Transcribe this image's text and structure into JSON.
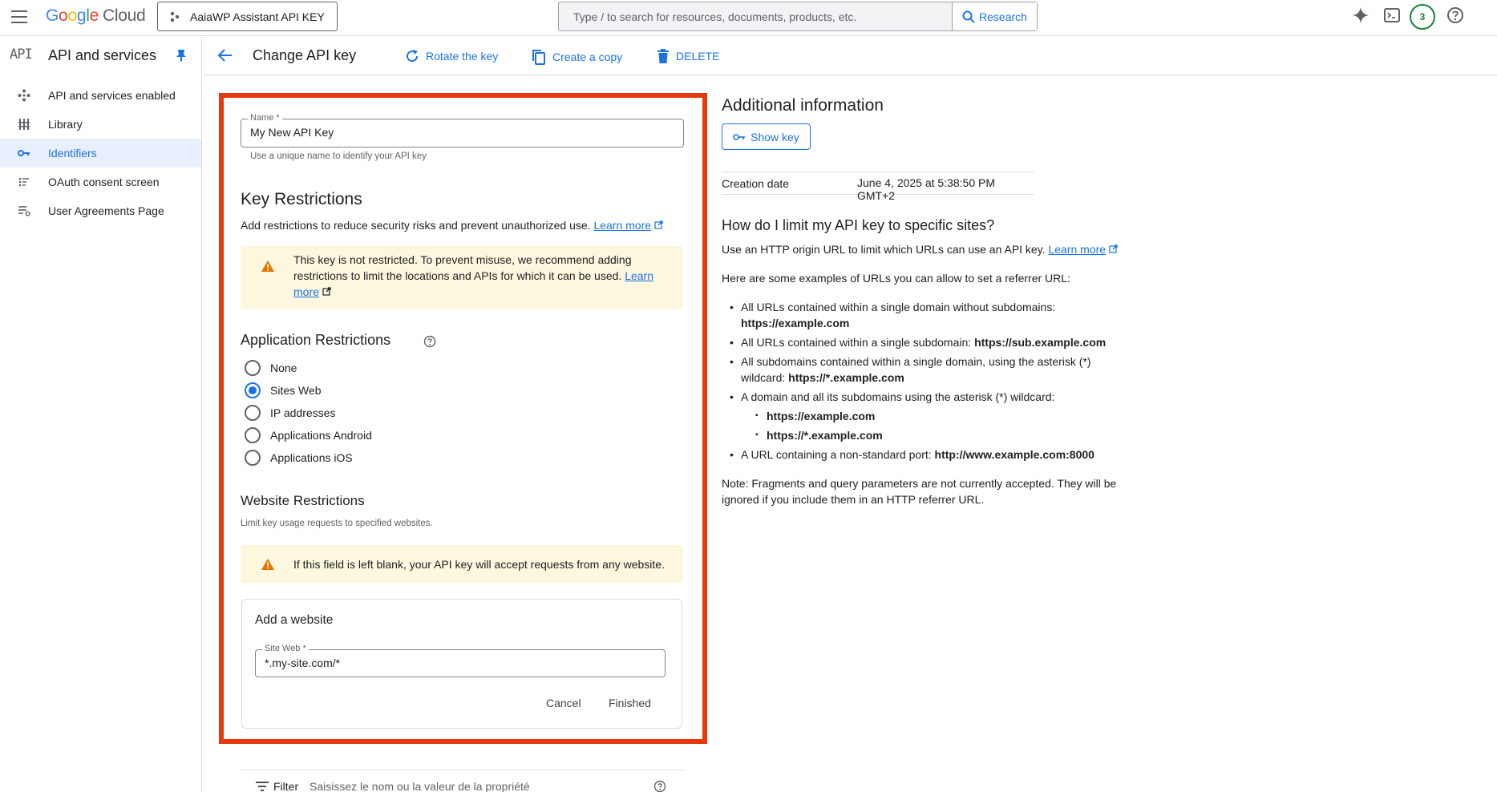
{
  "topbar": {
    "logo_letters": [
      "G",
      "o",
      "o",
      "g",
      "l",
      "e"
    ],
    "logo_cloud": "Cloud",
    "project": "AaiaWP Assistant API KEY",
    "search_placeholder": "Type / to search for resources, documents, products, etc.",
    "research_label": "Research",
    "notifications_count": "3"
  },
  "sidebar": {
    "api_badge": "API",
    "title": "API and services",
    "items": [
      {
        "label": "API and services enabled",
        "icon": "hub-icon"
      },
      {
        "label": "Library",
        "icon": "library-icon"
      },
      {
        "label": "Identifiers",
        "icon": "key-icon",
        "active": true
      },
      {
        "label": "OAuth consent screen",
        "icon": "consent-icon"
      },
      {
        "label": "User Agreements Page",
        "icon": "settings-list-icon"
      }
    ]
  },
  "header": {
    "title": "Change API key",
    "rotate": "Rotate the key",
    "copy": "Create a copy",
    "delete": "DELETE"
  },
  "form": {
    "name_label": "Name *",
    "name_value": "My New API Key",
    "name_hint": "Use a unique name to identify your API key",
    "key_restrictions_title": "Key Restrictions",
    "key_restrictions_desc": "Add restrictions to reduce security risks and prevent unauthorized use.",
    "learn_more": "Learn more",
    "warning1_line1": "This key is not restricted. To prevent misuse, we recommend adding",
    "warning1_line2": "restrictions to limit the locations and APIs for which it can be used.",
    "warning1_link_a": "Learn",
    "warning1_link_b": "more",
    "app_restrictions_title": "Application Restrictions",
    "app_options": [
      "None",
      "Sites Web",
      "IP addresses",
      "Applications Android",
      "Applications iOS"
    ],
    "app_selected": "Sites Web",
    "website_restrictions_title": "Website Restrictions",
    "website_restrictions_desc": "Limit key usage requests to specified websites.",
    "warning2": "If this field is left blank, your API key will accept requests from any website.",
    "add_website_title": "Add a website",
    "site_label": "Site Web *",
    "site_value": "*.my-site.com/*",
    "cancel": "Cancel",
    "finished": "Finished"
  },
  "filter": {
    "label": "Filter",
    "placeholder": "Saisissez le nom ou la valeur de la propriété"
  },
  "info": {
    "title": "Additional information",
    "show_key": "Show key",
    "creation_label": "Creation date",
    "creation_value": "June 4, 2025 at 5:38:50 PM GMT+2",
    "faq_title": "How do I limit my API key to specific sites?",
    "faq_desc": "Use an HTTP origin URL to limit which URLs can use an API key.",
    "learn_more": "Learn more",
    "examples_intro": "Here are some examples of URLs you can allow to set a referrer URL:",
    "ex1_text": "All URLs contained within a single domain without subdomains:",
    "ex1_url": "https://example.com",
    "ex2_text": "All URLs contained within a single subdomain:",
    "ex2_url": "https://sub.example.com",
    "ex3_text_a": "All subdomains contained within a single domain, using the asterisk (*)",
    "ex3_text_b": "wildcard:",
    "ex3_url": "https://*.example.com",
    "ex4_text": "A domain and all its subdomains using the asterisk (*) wildcard:",
    "ex4_sub1": "https://example.com",
    "ex4_sub2": "https://*.example.com",
    "ex5_text": "A URL containing a non-standard port:",
    "ex5_url": "http://www.example.com:8000",
    "note_line1": "Note: Fragments and query parameters are not currently accepted. They will be",
    "note_line2": "ignored if you include them in an HTTP referrer URL."
  }
}
